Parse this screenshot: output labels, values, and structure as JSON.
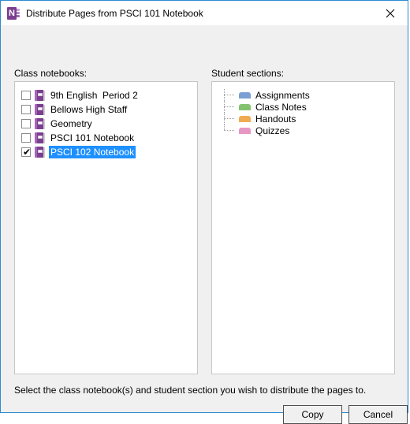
{
  "window": {
    "title": "Distribute Pages from PSCI 101 Notebook",
    "app_icon": "onenote-icon",
    "app_icon_letter": "N",
    "close_label": "✕",
    "border_color": "#2e8bd0"
  },
  "panels": {
    "left": {
      "label": "Class notebooks:",
      "items": [
        {
          "name": "9th English  Period 2",
          "checked": false,
          "selected": false
        },
        {
          "name": "Bellows High Staff",
          "checked": false,
          "selected": false
        },
        {
          "name": "Geometry",
          "checked": false,
          "selected": false
        },
        {
          "name": "PSCI 101 Notebook",
          "checked": false,
          "selected": false
        },
        {
          "name": "PSCI 102 Notebook",
          "checked": true,
          "selected": true
        }
      ]
    },
    "right": {
      "label": "Student sections:",
      "items": [
        {
          "name": "Assignments",
          "color": "#7b9fd4"
        },
        {
          "name": "Class Notes",
          "color": "#84c26e"
        },
        {
          "name": "Handouts",
          "color": "#f0ab52"
        },
        {
          "name": "Quizzes",
          "color": "#e896c4"
        }
      ]
    }
  },
  "footer": {
    "instruction": "Select the class notebook(s) and student section you wish to distribute the pages to.",
    "copy_label": "Copy",
    "cancel_label": "Cancel"
  },
  "colors": {
    "selection": "#1e90ff",
    "notebook_icon": "#7b3f8f",
    "dialog_background": "#f0f0f0",
    "listbox_background": "#ffffff"
  }
}
